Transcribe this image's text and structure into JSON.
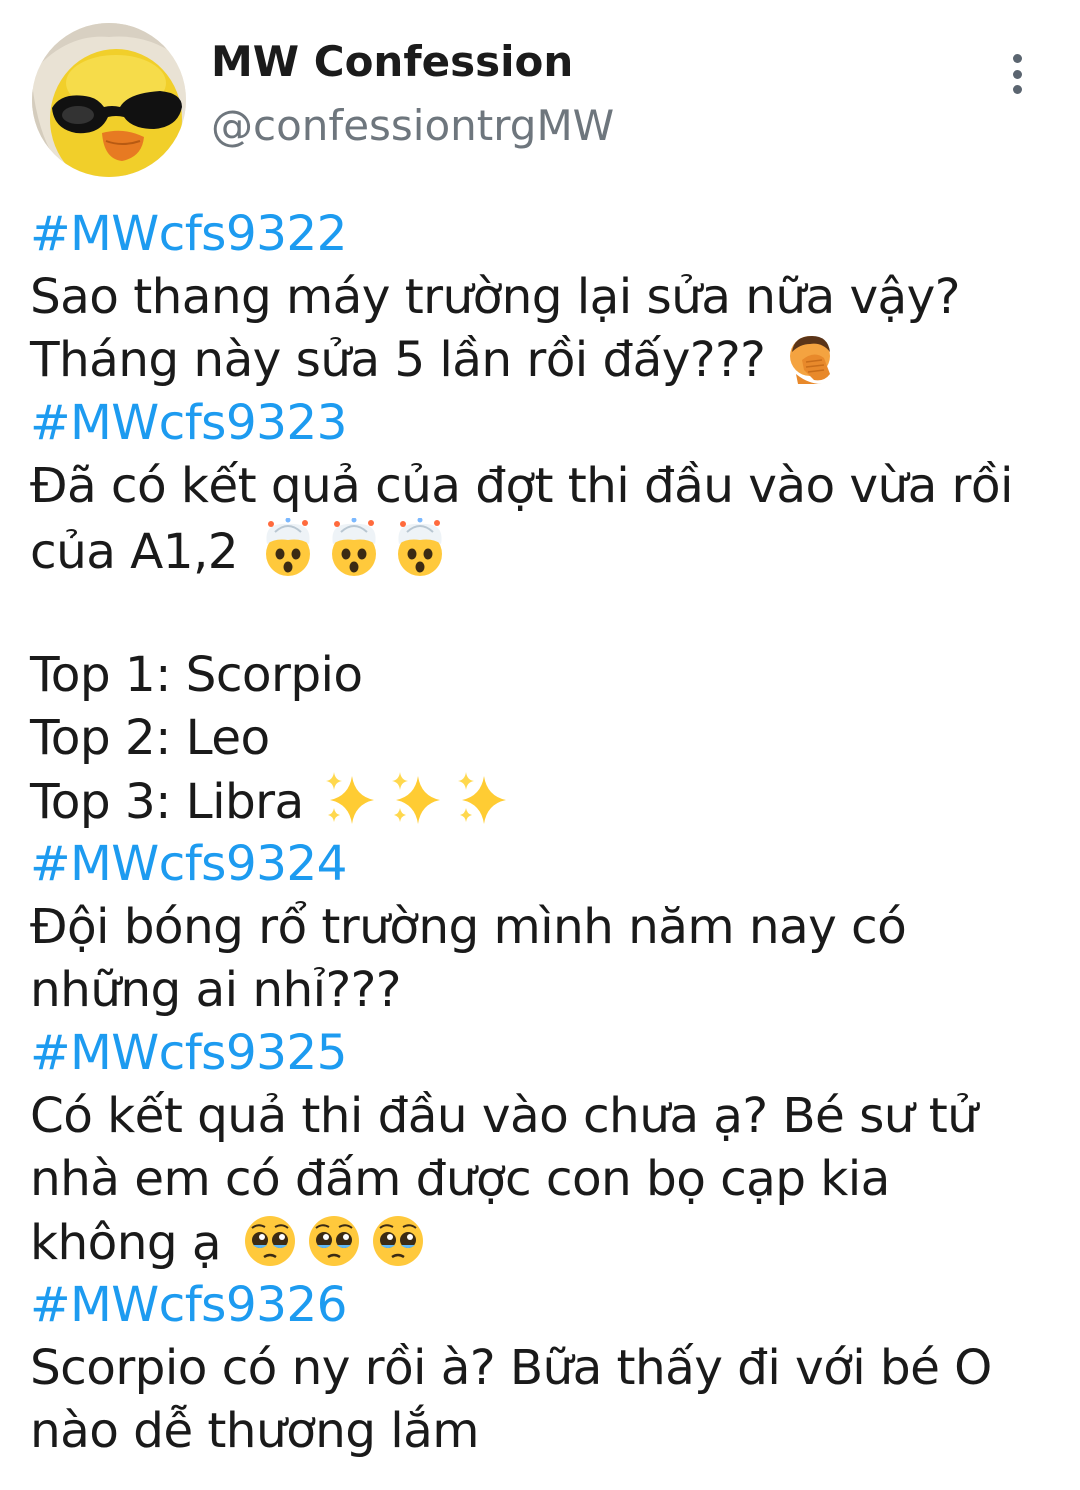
{
  "profile": {
    "display_name": "MW Confession",
    "handle": "@confessiontrgMW",
    "avatar_icon": "duck-with-sunglasses-avatar"
  },
  "menu": {
    "icon": "more-vertical-icon"
  },
  "colors": {
    "hashtag": "#1d9bf0",
    "handle": "#6e767d",
    "text": "#1a1a1a"
  },
  "posts": [
    {
      "tag": "#MWcfs9322",
      "lines": [
        "Sao thang máy trường lại sửa nữa vậy?",
        "Tháng này sửa 5 lần rồi đấy???"
      ],
      "emoji": "face-palm-emoji"
    },
    {
      "tag": "#MWcfs9323",
      "lines": [
        "Đã có kết quả của đợt thi đầu vào vừa rồi",
        "của A1,2"
      ],
      "emoji": "exploding-head-emoji",
      "ranking": [
        "Top 1: Scorpio",
        "Top 2: Leo",
        "Top 3: Libra"
      ],
      "ranking_emoji": "sparkles-emoji"
    },
    {
      "tag": "#MWcfs9324",
      "lines": [
        "Đội bóng rổ trường mình năm nay có",
        "những ai nhỉ???"
      ]
    },
    {
      "tag": "#MWcfs9325",
      "lines": [
        "Có kết quả thi đầu vào chưa ạ? Bé sư tử",
        "nhà em có đấm được con bọ cạp kia",
        "không ạ"
      ],
      "emoji": "pleading-face-emoji"
    },
    {
      "tag": "#MWcfs9326",
      "lines": [
        "Scorpio có ny rồi à? Bữa thấy đi với bé O",
        "nào dễ thương lắm"
      ]
    }
  ]
}
